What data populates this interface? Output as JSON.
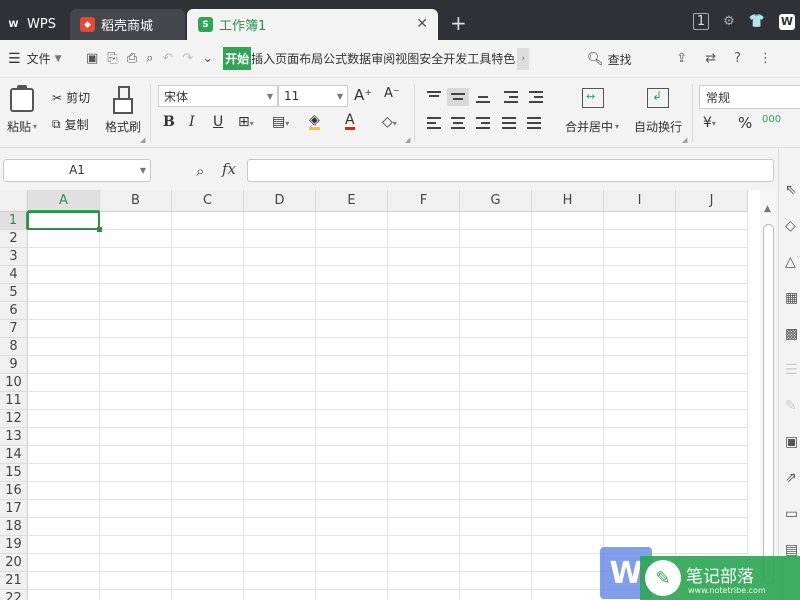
{
  "tabs": [
    {
      "label": "WPS",
      "icon": "wps-logo-icon"
    },
    {
      "label": "稻壳商城",
      "icon": "docer-icon"
    },
    {
      "label": "工作簿1",
      "icon": "sheet-icon",
      "active": true
    }
  ],
  "window_badge": "1",
  "menu": {
    "file": "文件",
    "tabs": [
      "开始",
      "插入",
      "页面布局",
      "公式",
      "数据",
      "审阅",
      "视图",
      "安全",
      "开发工具",
      "特色"
    ],
    "active_tab": "开始",
    "find": "查找"
  },
  "ribbon": {
    "paste": "粘贴",
    "cut": "剪切",
    "copy": "复制",
    "format_painter": "格式刷",
    "font_name": "宋体",
    "font_size": "11",
    "merge_center": "合并居中",
    "wrap_text": "自动换行",
    "number_format": "常规"
  },
  "formula_bar": {
    "name_box": "A1",
    "fx": "fx",
    "formula": ""
  },
  "grid": {
    "columns": [
      "A",
      "B",
      "C",
      "D",
      "E",
      "F",
      "G",
      "H",
      "I",
      "J"
    ],
    "rows": [
      "1",
      "2",
      "3",
      "4",
      "5",
      "6",
      "7",
      "8",
      "9",
      "10",
      "11",
      "12",
      "13",
      "14",
      "15",
      "16",
      "17",
      "18",
      "19",
      "20",
      "21",
      "22"
    ],
    "selected_cell": "A1"
  },
  "watermark": {
    "title": "笔记部落",
    "sub": "www.notetribe.com",
    "badge": "W"
  },
  "colors": {
    "accent": "#2fa655",
    "titlebar": "#2f3136"
  }
}
